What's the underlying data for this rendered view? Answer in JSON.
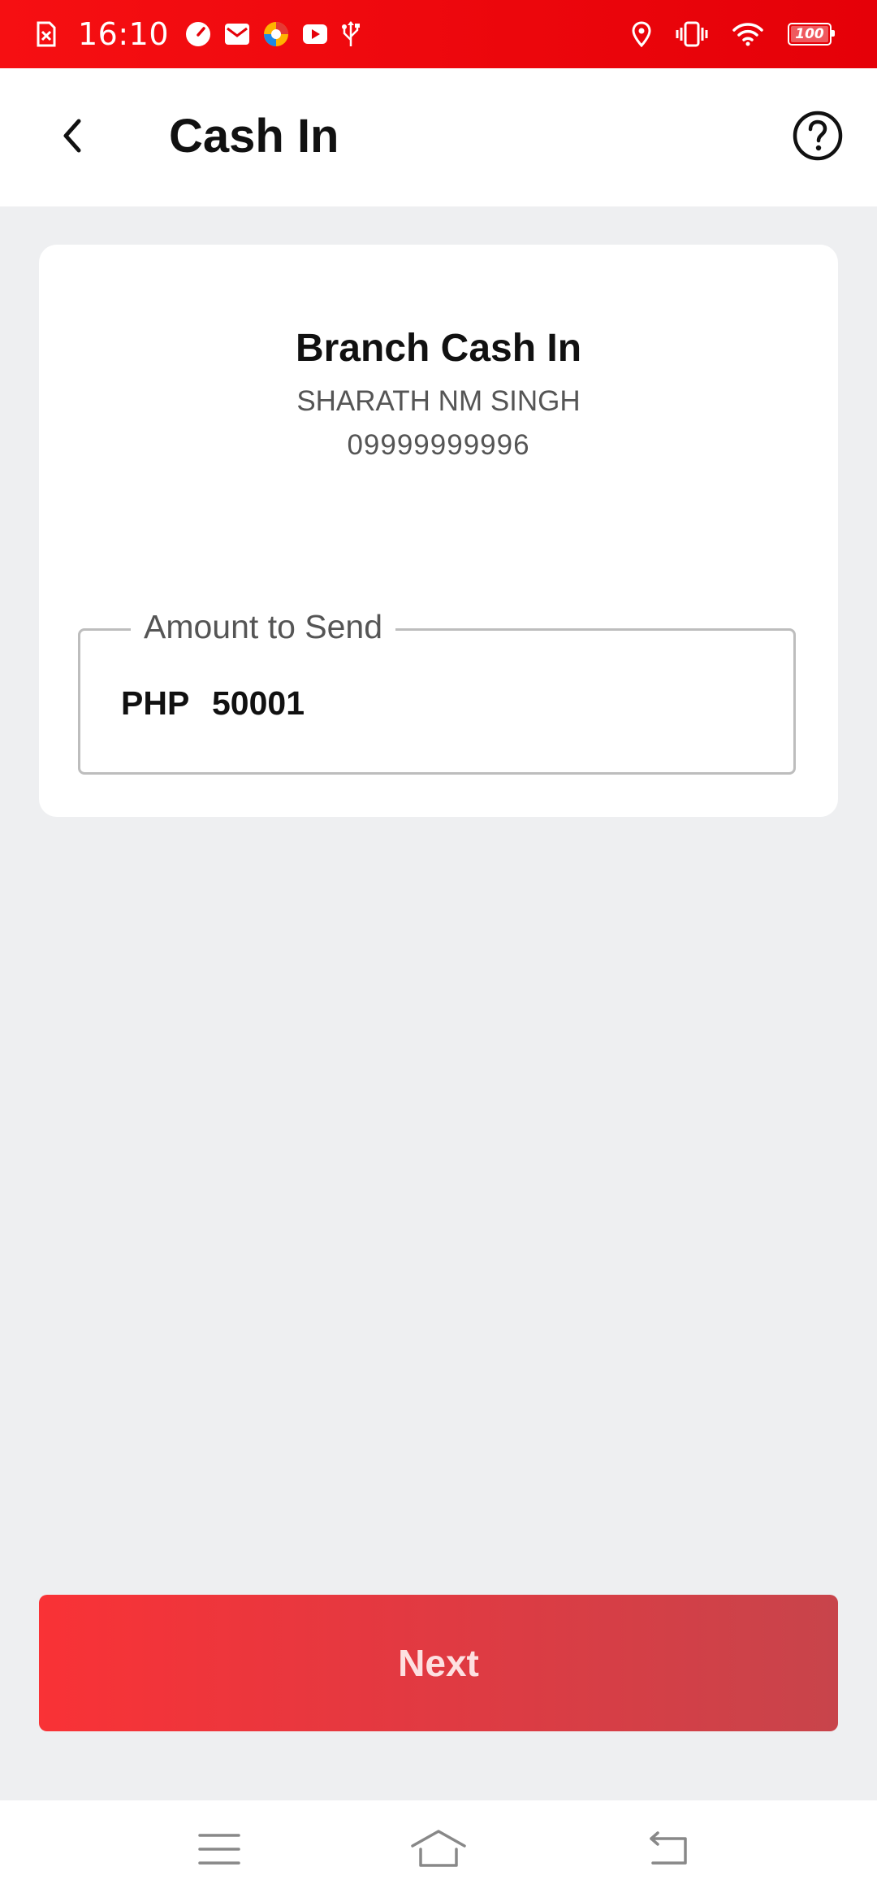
{
  "status_bar": {
    "time": "16:10",
    "battery_level": "100",
    "left_icons": [
      "screenshot-icon",
      "speedometer-icon",
      "mail-icon",
      "browser-icon",
      "youtube-icon",
      "usb-icon"
    ],
    "right_icons": [
      "location-icon",
      "vibrate-icon",
      "wifi-icon",
      "battery-icon"
    ]
  },
  "header": {
    "title": "Cash In",
    "back_icon": "chevron-left-icon",
    "help_icon": "help-circle-icon"
  },
  "card": {
    "title": "Branch Cash In",
    "name": "SHARATH NM SINGH",
    "phone": "09999999996",
    "amount_field": {
      "label": "Amount to Send",
      "currency": "PHP",
      "value": "50001"
    }
  },
  "actions": {
    "next_label": "Next"
  },
  "nav_bar": {
    "icons": [
      "menu-icon",
      "home-icon",
      "back-icon"
    ]
  },
  "colors": {
    "status_bar": "#f00a0e",
    "accent": "#f93236",
    "background": "#eeeff1"
  }
}
